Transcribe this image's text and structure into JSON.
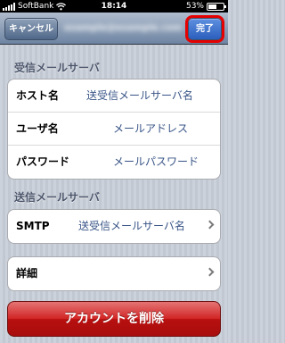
{
  "status_bar": {
    "carrier": "SoftBank",
    "time": "18:14",
    "battery_text": "53%",
    "battery_level": 0.53
  },
  "nav": {
    "cancel_label": "キャンセル",
    "done_label": "完了",
    "title": "example@example.com",
    "highlight_color": "#e60000"
  },
  "incoming": {
    "header": "受信メールサーバ",
    "rows": [
      {
        "label": "ホスト名",
        "value": "送受信メールサーバ名"
      },
      {
        "label": "ユーザ名",
        "value": "メールアドレス"
      },
      {
        "label": "パスワード",
        "value": "メールパスワード"
      }
    ]
  },
  "outgoing": {
    "header": "送信メールサーバ",
    "smtp_label": "SMTP",
    "smtp_value": "送受信メールサーバ名"
  },
  "advanced": {
    "label": "詳細"
  },
  "delete_button": {
    "label": "アカウントを削除",
    "color": "#c81a1a"
  },
  "icons": [
    "signal-bars-icon",
    "wifi-icon",
    "battery-icon",
    "chevron-right-icon"
  ]
}
